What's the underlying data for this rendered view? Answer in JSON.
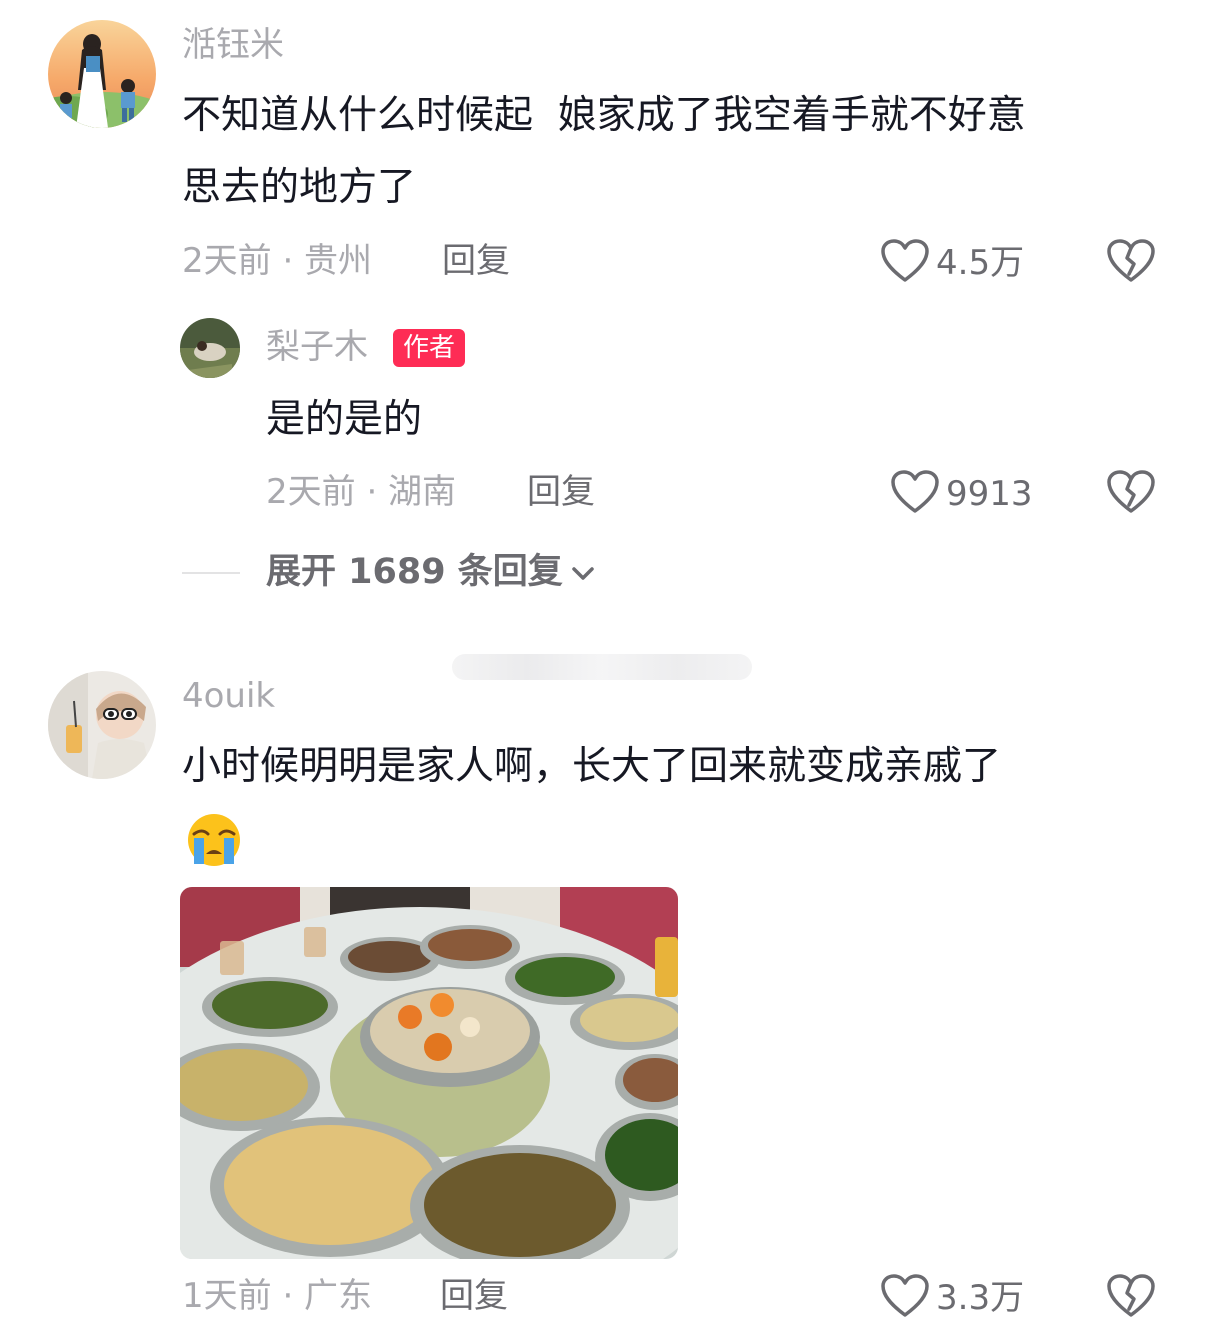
{
  "comments": [
    {
      "username": "湉钰米",
      "text_line1": "不知道从什么时候起  娘家成了我空着手就不好意",
      "text_line2": "思去的地方了",
      "time_location": "2天前 · 贵州",
      "reply_label": "回复",
      "likes": "4.5万",
      "replies": [
        {
          "username": "梨子木",
          "badge": "作者",
          "text": "是的是的",
          "time_location": "2天前 · 湖南",
          "reply_label": "回复",
          "likes": "9913"
        }
      ],
      "expand_label": "展开 1689 条回复"
    },
    {
      "username": "4ouik",
      "text": "小时候明明是家人啊，长大了回来就变成亲戚了",
      "emoji": "😭",
      "time_location": "1天前 · 广东",
      "reply_label": "回复",
      "likes": "3.3万"
    }
  ],
  "icons": {
    "like": "heart-outline-icon",
    "dislike": "broken-heart-icon",
    "expand": "chevron-down-icon"
  },
  "colors": {
    "accent": "#fe2c55",
    "muted_text": "#a9a9ae",
    "secondary_text": "#6b6b70",
    "primary_text": "#161823"
  }
}
